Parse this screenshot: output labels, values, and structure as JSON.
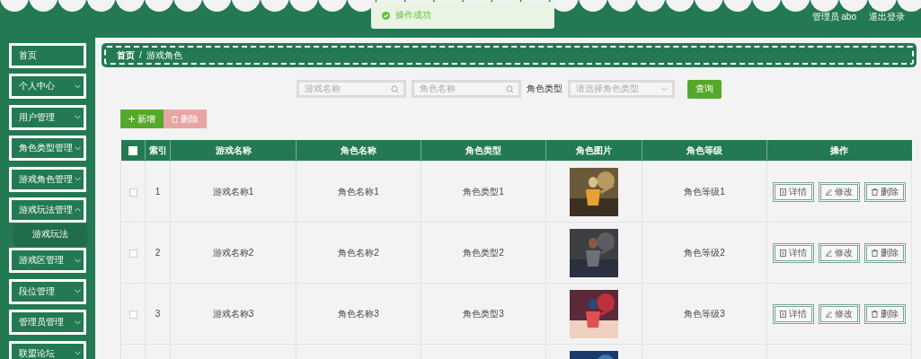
{
  "header": {
    "user": "管理员 abo",
    "logout": "退出登录"
  },
  "toast": {
    "message": "操作成功"
  },
  "sidebar": {
    "items": [
      {
        "label": "首页"
      },
      {
        "label": "个人中心",
        "expanded": false
      },
      {
        "label": "用户管理",
        "expanded": false
      },
      {
        "label": "角色类型管理",
        "expanded": false
      },
      {
        "label": "游戏角色管理",
        "expanded": false
      },
      {
        "label": "游戏玩法管理",
        "expanded": true,
        "children": [
          {
            "label": "游戏玩法"
          }
        ]
      },
      {
        "label": "游戏区管理",
        "expanded": false
      },
      {
        "label": "段位管理",
        "expanded": false
      },
      {
        "label": "管理员管理",
        "expanded": false
      },
      {
        "label": "联盟论坛",
        "expanded": false
      }
    ]
  },
  "breadcrumb": [
    "首页",
    "/",
    "游戏角色"
  ],
  "search": {
    "fields": [
      {
        "placeholder": "游戏名称"
      },
      {
        "placeholder": "角色名称"
      }
    ],
    "type_label": "角色类型",
    "type_select": {
      "placeholder": "请选择角色类型"
    },
    "query_button": "查询"
  },
  "toolbar": {
    "add": "新增",
    "delete": "删除"
  },
  "table": {
    "columns": [
      "索引",
      "游戏名称",
      "角色名称",
      "角色类型",
      "角色图片",
      "角色等级",
      "操作"
    ],
    "select_all": {
      "checked": false
    },
    "rows": [
      {
        "checked": false,
        "index": "1",
        "game": "游戏名称1",
        "role": "角色名称1",
        "type": "角色类型1",
        "image": {
          "kind": "picture"
        },
        "level": "角色等级1",
        "actions": [
          "详情",
          "修改",
          "删除"
        ]
      },
      {
        "checked": false,
        "index": "2",
        "game": "游戏名称2",
        "role": "角色名称2",
        "type": "角色类型2",
        "image": {
          "kind": "picture"
        },
        "level": "角色等级2",
        "actions": [
          "详情",
          "修改",
          "删除"
        ]
      },
      {
        "checked": false,
        "index": "3",
        "game": "游戏名称3",
        "role": "角色名称3",
        "type": "角色类型3",
        "image": {
          "kind": "picture"
        },
        "level": "角色等级3",
        "actions": [
          "详情",
          "修改",
          "删除"
        ]
      },
      {
        "image": {
          "kind": "picture"
        }
      }
    ]
  }
}
